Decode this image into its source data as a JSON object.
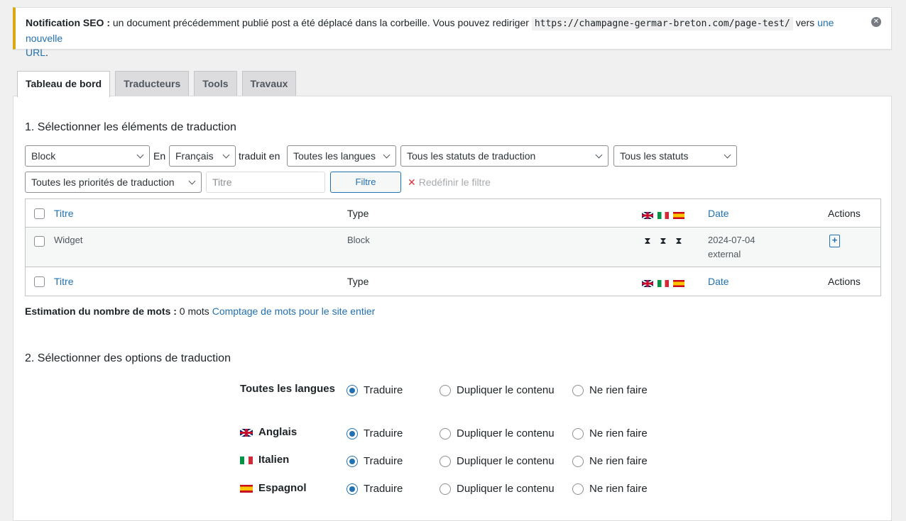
{
  "notice": {
    "label": "Notification SEO :",
    "text": " un document précédemment publié post a été déplacé dans la corbeille. Vous pouvez rediriger ",
    "url": "https://champagne-germar-breton.com/page-test/",
    "vers": " vers ",
    "link1": "une nouvelle",
    "link2": "URL",
    "period": "."
  },
  "tabs": [
    "Tableau de bord",
    "Traducteurs",
    "Tools",
    "Travaux"
  ],
  "section1": {
    "title": "1. Sélectionner les éléments de traduction",
    "type_select": "Block",
    "en_label": "En",
    "source_lang": "Français",
    "translated_in": "traduit en",
    "target_lang": "Toutes les langues",
    "translation_status": "Tous les statuts de traduction",
    "status": "Tous les statuts",
    "priority": "Toutes les priorités de traduction",
    "title_placeholder": "Titre",
    "filter_button": "Filtre",
    "reset_filter": "Redéfinir le filtre"
  },
  "table": {
    "columns": {
      "title": "Titre",
      "type": "Type",
      "date": "Date",
      "actions": "Actions"
    },
    "rows": [
      {
        "title": "Widget",
        "type": "Block",
        "date": "2024-07-04",
        "source": "external"
      }
    ]
  },
  "word_count": {
    "label": "Estimation du nombre de mots :",
    "value": " 0 mots ",
    "link": "Comptage de mots pour le site entier"
  },
  "section2": {
    "title": "2. Sélectionner des options de traduction",
    "all_languages": "Toutes les langues",
    "languages": [
      "Anglais",
      "Italien",
      "Espagnol"
    ],
    "options": [
      "Traduire",
      "Dupliquer le contenu",
      "Ne rien faire"
    ]
  },
  "colors": {
    "accent": "#2271b1",
    "warning_border": "#dba617"
  },
  "icons": {
    "close": "close-circle-icon",
    "hourglass": "hourglass-icon",
    "add_translation": "document-plus-icon"
  }
}
